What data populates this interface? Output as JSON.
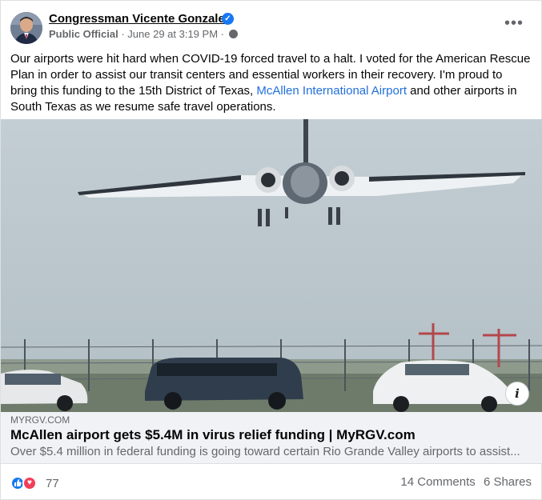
{
  "post": {
    "author": "Congressman Vicente Gonzalez",
    "author_role": "Public Official",
    "timestamp": "June 29 at 3:19 PM",
    "meta_separator": "·",
    "privacy_icon": "globe-icon",
    "more_label": "•••",
    "text_before_link": "Our airports were hit hard when COVID-19 forced travel to a halt. I voted for the American Rescue Plan in order to assist our transit centers and essential workers in their recovery. I'm proud to bring this funding to the 15th District of Texas, ",
    "text_link": "McAllen International Airport",
    "text_after_link": " and other airports in South Texas as we resume safe travel operations."
  },
  "link_preview": {
    "domain": "MYRGV.COM",
    "title": "McAllen airport gets $5.4M in virus relief funding | MyRGV.com",
    "description": "Over $5.4 million in federal funding is going toward certain Rio Grande Valley airports to assist..."
  },
  "engagement": {
    "reaction_count": "77",
    "reactions": [
      "like",
      "love"
    ],
    "comments": "14 Comments",
    "shares": "6 Shares"
  },
  "colors": {
    "accent": "#1877f2",
    "link": "#216fdb",
    "love": "#f33e58",
    "secondary_text": "#65676b"
  }
}
